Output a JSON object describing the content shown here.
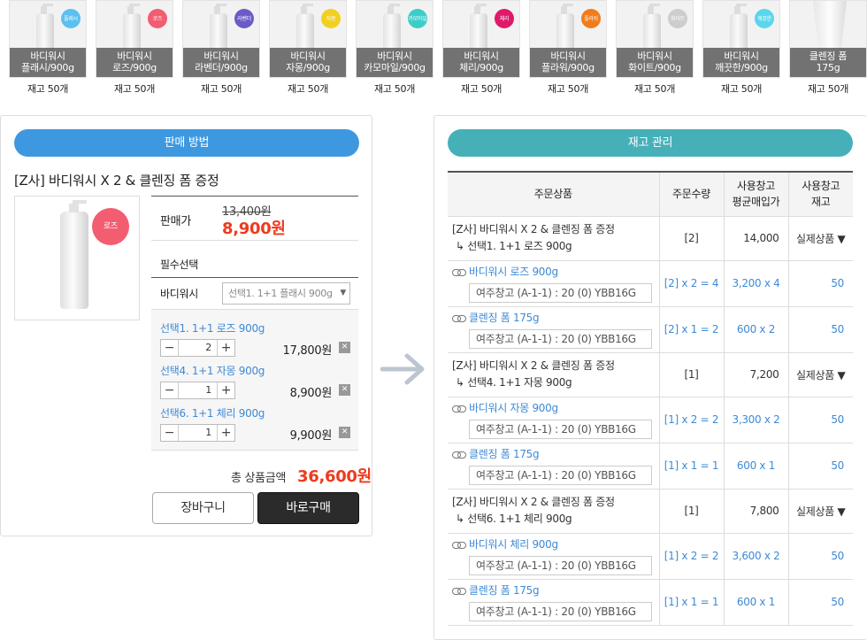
{
  "products": [
    {
      "line1": "바디워시",
      "line2": "플래시/900g",
      "badge": "플래시",
      "color": "#5bc0f0",
      "stock": "재고 50개",
      "shape": "bottle"
    },
    {
      "line1": "바디워시",
      "line2": "로즈/900g",
      "badge": "로즈",
      "color": "#f25d72",
      "stock": "재고 50개",
      "shape": "bottle"
    },
    {
      "line1": "바디워시",
      "line2": "라벤더/900g",
      "badge": "라벤더",
      "color": "#6a5bc7",
      "stock": "재고 50개",
      "shape": "bottle"
    },
    {
      "line1": "바디워시",
      "line2": "자몽/900g",
      "badge": "자몽",
      "color": "#f2d022",
      "stock": "재고 50개",
      "shape": "bottle"
    },
    {
      "line1": "바디워시",
      "line2": "카모마일/900g",
      "badge": "카모마일",
      "color": "#3ccdc8",
      "stock": "재고 50개",
      "shape": "bottle"
    },
    {
      "line1": "바디워시",
      "line2": "체리/900g",
      "badge": "체리",
      "color": "#e0196b",
      "stock": "재고 50개",
      "shape": "bottle"
    },
    {
      "line1": "바디워시",
      "line2": "플라워/900g",
      "badge": "플라워",
      "color": "#f07d1a",
      "stock": "재고 50개",
      "shape": "bottle"
    },
    {
      "line1": "바디워시",
      "line2": "화이트/900g",
      "badge": "화이트",
      "color": "#cdcdcd",
      "stock": "재고 50개",
      "shape": "bottle"
    },
    {
      "line1": "바디워시",
      "line2": "깨끗한/900g",
      "badge": "깨끗한",
      "color": "#5ad6ec",
      "stock": "재고 50개",
      "shape": "bottle"
    },
    {
      "line1": "클렌징 폼",
      "line2": "175g",
      "badge": "",
      "color": "",
      "stock": "재고 50개",
      "shape": "tube"
    }
  ],
  "sale": {
    "header": "판매 방법",
    "title": "[Z사] 바디워시 X 2 & 클렌징 폼 증정",
    "badge": "로즈",
    "price_label": "판매가",
    "orig_price": "13,400원",
    "price": "8,900원",
    "required": "필수선택",
    "select_label": "바디워시",
    "select_value": "선택1. 1+1 플래시 900g",
    "options": [
      {
        "name": "선택1. 1+1 로즈 900g",
        "qty": "2",
        "price": "17,800원"
      },
      {
        "name": "선택4. 1+1 자몽 900g",
        "qty": "1",
        "price": "8,900원"
      },
      {
        "name": "선택6. 1+1 체리 900g",
        "qty": "1",
        "price": "9,900원"
      }
    ],
    "total_label": "총 상품금액",
    "total": "36,600원",
    "cart": "장바구니",
    "buy": "바로구매"
  },
  "stock": {
    "header": "재고 관리",
    "cols": {
      "product": "주문상품",
      "qty": "주문수량",
      "avg1": "사용창고",
      "avg2": "평균매입가",
      "stock1": "사용창고",
      "stock2": "재고"
    },
    "groups": [
      {
        "main": "[Z사] 바디워시 X 2 & 클렌징 폼 증정",
        "sub": "↳ 선택1. 1+1 로즈 900g",
        "qty": "[2]",
        "price": "14,000",
        "kind": "실제상품 ▼",
        "items": [
          {
            "name": "바디워시 로즈 900g",
            "wh": "여주창고 (A-1-1) : 20 (0) YBB16G",
            "qty": "[2] x 2 = 4",
            "avg": "3,200 x 4",
            "stock": "50"
          },
          {
            "name": "클렌징 폼 175g",
            "wh": "여주창고 (A-1-1) : 20 (0) YBB16G",
            "qty": "[2] x 1 = 2",
            "avg": "600 x 2",
            "stock": "50"
          }
        ]
      },
      {
        "main": "[Z사] 바디워시 X 2 & 클렌징 폼 증정",
        "sub": "↳ 선택4. 1+1 자몽 900g",
        "qty": "[1]",
        "price": "7,200",
        "kind": "실제상품 ▼",
        "items": [
          {
            "name": "바디워시 자몽 900g",
            "wh": "여주창고 (A-1-1) : 20 (0) YBB16G",
            "qty": "[1] x 2 = 2",
            "avg": "3,300 x 2",
            "stock": "50"
          },
          {
            "name": "클렌징 폼 175g",
            "wh": "여주창고 (A-1-1) : 20 (0) YBB16G",
            "qty": "[1] x 1 = 1",
            "avg": "600 x 1",
            "stock": "50"
          }
        ]
      },
      {
        "main": "[Z사] 바디워시 X 2 & 클렌징 폼 증정",
        "sub": "↳ 선택6. 1+1 체리 900g",
        "qty": "[1]",
        "price": "7,800",
        "kind": "실제상품 ▼",
        "items": [
          {
            "name": "바디워시 체리 900g",
            "wh": "여주창고 (A-1-1) : 20 (0) YBB16G",
            "qty": "[1] x 2 = 2",
            "avg": "3,600 x 2",
            "stock": "50"
          },
          {
            "name": "클렌징 폼 175g",
            "wh": "여주창고 (A-1-1) : 20 (0) YBB16G",
            "qty": "[1] x 1 = 1",
            "avg": "600 x 1",
            "stock": "50"
          }
        ]
      }
    ]
  }
}
